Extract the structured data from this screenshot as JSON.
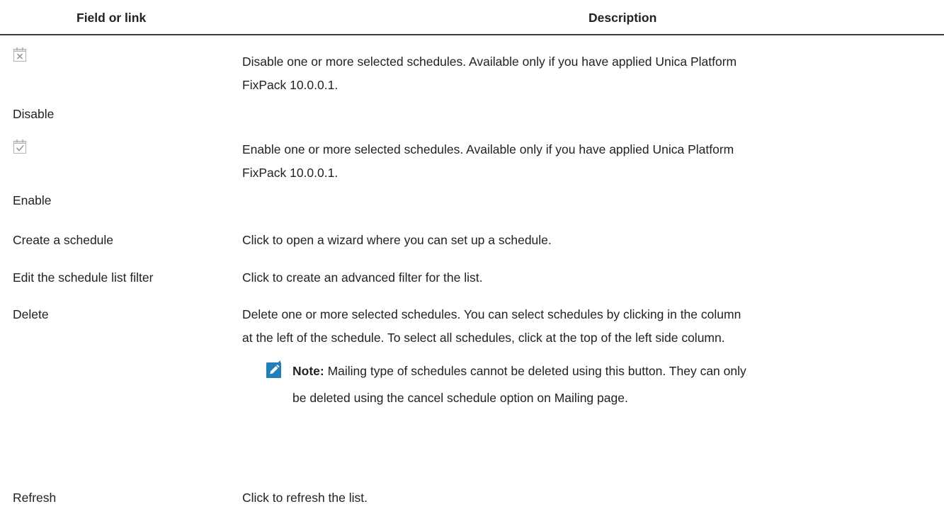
{
  "table": {
    "headers": {
      "field": "Field or link",
      "description": "Description"
    },
    "rows": [
      {
        "field": "Disable",
        "icon": "calendar-disable-icon",
        "description_lines": [
          "Disable one or more selected schedules. Available only if you have applied Unica Platform",
          "FixPack 10.0.0.1."
        ]
      },
      {
        "field": "Enable",
        "icon": "calendar-enable-icon",
        "description_lines": [
          "Enable one or more selected schedules. Available only if you have applied Unica Platform",
          "FixPack 10.0.0.1."
        ]
      },
      {
        "field": "Create a schedule",
        "description_lines": [
          "Click to open a wizard where you can set up a schedule."
        ]
      },
      {
        "field": "Edit the schedule list filter",
        "description_lines": [
          "Click to create an advanced filter for the list."
        ]
      },
      {
        "field": "Delete",
        "description_lines": [
          "Delete one or more selected schedules. You can select schedules by clicking in the column",
          "at the left of the schedule. To select all schedules, click at the top of the left side column."
        ],
        "note": {
          "label": "Note:",
          "icon": "pencil-note-icon",
          "lines": [
            " Mailing type of schedules cannot be deleted using this button. They can only",
            "be deleted using the cancel schedule option on Mailing page."
          ]
        }
      },
      {
        "field": "Refresh",
        "description_lines": [
          "Click to refresh the list."
        ]
      }
    ]
  },
  "colors": {
    "text": "#222222",
    "icon_gray": "#a6a6a6",
    "note_blue": "#1f7fb6"
  }
}
